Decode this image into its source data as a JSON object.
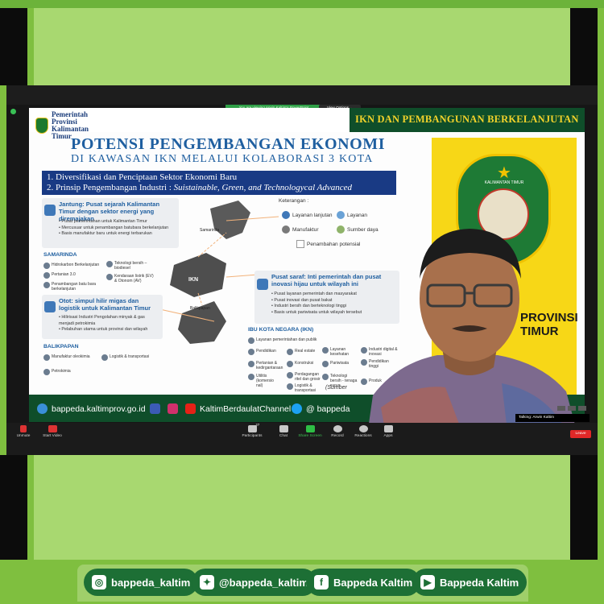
{
  "colors": {
    "outer_green": "#7fbf3f",
    "pale_green": "#a8d870",
    "dark_green": "#0f4e2a",
    "pill_green": "#1d6f35",
    "slide_blue": "#1f5fa0",
    "banner_navy": "#193a84",
    "gold": "#f7d717",
    "leave_red": "#e02828"
  },
  "zoom": {
    "viewing_banner": "You are viewing Arwin Kaltim's PowerPoint",
    "view_options": "View Options ⌄",
    "talking": "Talking: Arwin Kaltim",
    "toolbar": {
      "unmute": "Unmute",
      "start_video": "Start Video",
      "participants": "Participants",
      "participants_count": "27",
      "chat": "Chat",
      "share_screen": "Share Screen",
      "record": "Record",
      "reactions": "Reactions",
      "apps": "Apps",
      "leave": "Leave"
    }
  },
  "slide": {
    "org": "Pemerintah Provinsi Kalimantan Timur",
    "header_tag": "IKN DAN PEMBANGUNAN BERKELANJUTAN",
    "title_line1": "POTENSI PENGEMBANGAN EKONOMI",
    "title_line2": "DI KAWASAN IKN MELALUI KOLABORASI 3 KOTA",
    "banner_line1": "1. Diversifikasi dan Penciptaan Sektor Ekonomi Baru",
    "banner_line2_prefix": "2. Prinsip Pengembangan Industri : ",
    "banner_line2_italic": "Suistainable, Green, and Technologycal Advanced",
    "keterangan": {
      "title": "Keterangan :",
      "layanan_lanjutan": "Layanan lanjutan",
      "layanan": "Layanan",
      "manufaktur": "Manufaktur",
      "sumber_daya": "Sumber daya",
      "penambahan_potensial": "Penambahan potensial"
    },
    "jantung": {
      "title": "Jantung: Pusat sejarah Kalimantan Timur dengan sektor energi yang diremajakan",
      "b1": "Pusat pemerintahan untuk Kalimantan Timur",
      "b2": "Mercusuar untuk penambangan batubara berkelanjutan",
      "b3": "Basis manufaktur baru untuk energi terbarukan"
    },
    "samarinda": {
      "header": "SAMARINDA",
      "i1": "Hidrokarbon Berkelanjutan",
      "i2": "Pertanian 3.0",
      "i3": "Penambangan batu bara berkelanjutan",
      "i4": "Teknologi bersih – biodiesel",
      "i5": "Kendaraan listrik (EV) & Otonom (AV)"
    },
    "otot": {
      "title": "Otot: simpul hilir migas dan logistik untuk Kalimantan Timur",
      "b1": "Hilirisasi Industri Pengolahan minyak & gas menjadi petrokimia",
      "b2": "Pelabuhan utama untuk provinsi dan wilayah"
    },
    "balikpapan": {
      "header": "BALIKPAPAN",
      "i1": "Manufaktur oleokimia",
      "i2": "Logistik & transportasi",
      "i3": "Petrokimia"
    },
    "pusat": {
      "title": "Pusat saraf: Inti pemerintah dan pusat inovasi hijau untuk wilayah ini",
      "b1": "Pusat layanan pemerintah dan masyarakat",
      "b2": "Pusat inovasi dan pusat bakat",
      "b3": "Industri bersih dan berteknologi tinggi",
      "b4": "Basis untuk pariwisata untuk wilayah tersebut"
    },
    "ibu_kota": {
      "header": "IBU KOTA NEGARA (IKN)",
      "i1": "Layanan pemerintahan dan publik",
      "i2": "Pendidikan",
      "i3": "Real estate",
      "i4": "Layanan kesehatan",
      "i5": "Industri digital & inovasi",
      "i6": "Pertanian & kedirgantaraan",
      "i7": "Konstruksi",
      "i8": "Pariwisata",
      "i9": "Pendidikan tinggi",
      "i10": "Utilitis (komersio nal)",
      "i11": "Perdagangan ritel dan grosir",
      "i12": "Teknologi bersih - tenaga surya",
      "i13": "Produk",
      "i14": "Logistik & transportasi"
    },
    "map_labels": {
      "samarinda": "Samarinda",
      "ikn": "IKN",
      "balikpapan": "Balikpapan"
    },
    "sumber": "(Sumber",
    "provinsi_text": "PROVINSI TIMUR",
    "emblem_text": "KALIMANTAN TIMUR",
    "footer": {
      "website": "bappeda.kaltimprov.go.id",
      "channel": "KaltimBerdaulatChannel",
      "twitter": "@ bappeda"
    }
  },
  "social": {
    "instagram": "bappeda_kaltim",
    "twitter": "@bappeda_kaltim",
    "facebook": "Bappeda Kaltim",
    "youtube": "Bappeda Kaltim"
  }
}
